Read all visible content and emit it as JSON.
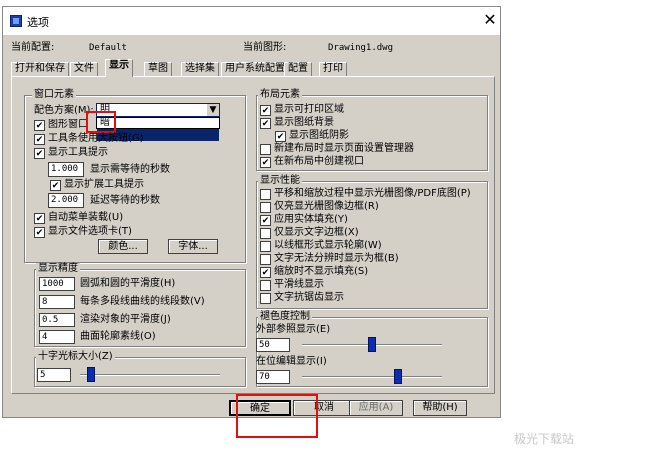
{
  "window": {
    "title": "选项",
    "close_glyph": "✕",
    "current_config_label": "当前配置:",
    "current_config_value": "Default",
    "current_drawing_label": "当前图形:",
    "current_drawing_value": "Drawing1.dwg"
  },
  "tabs": [
    {
      "label": "打开和保存"
    },
    {
      "label": "文件"
    },
    {
      "label": "显示"
    },
    {
      "label": "草图"
    },
    {
      "label": "选择集"
    },
    {
      "label": "用户系统配置"
    },
    {
      "label": "配置"
    },
    {
      "label": "打印"
    }
  ],
  "window_elements": {
    "title": "窗口元素",
    "color_scheme_label": "配色方案(M):",
    "color_scheme_value": "明",
    "color_scheme_options": [
      "暗"
    ],
    "checkboxes": [
      {
        "label": "图形窗口中显示滚动条",
        "checked": true
      },
      {
        "label": "工具条使用大按钮(G)",
        "checked": true
      },
      {
        "label": "显示工具提示",
        "checked": true
      }
    ],
    "tooltip_delay_value": "1.000",
    "tooltip_delay_label": "显示需等待的秒数",
    "extended_tooltip": {
      "label": "显示扩展工具提示",
      "checked": true
    },
    "extended_delay_value": "2.000",
    "extended_delay_label": "延迟等待的秒数",
    "auto_menu": {
      "label": "自动菜单装载(U)",
      "checked": true
    },
    "file_tab": {
      "label": "显示文件选项卡(T)",
      "checked": true
    },
    "color_button": "颜色...",
    "font_button": "字体..."
  },
  "display_precision": {
    "title": "显示精度",
    "rows": [
      {
        "value": "1000",
        "label": "圆弧和圆的平滑度(H)"
      },
      {
        "value": "8",
        "label": "每条多段线曲线的线段数(V)"
      },
      {
        "value": "0.5",
        "label": "渲染对象的平滑度(J)"
      },
      {
        "value": "4",
        "label": "曲面轮廓素线(O)"
      }
    ]
  },
  "crosshair": {
    "title": "十字光标大小(Z)",
    "value": "5",
    "slider_fraction": 0.05
  },
  "layout_elements": {
    "title": "布局元素",
    "checkboxes": [
      {
        "label": "显示可打印区域",
        "checked": true
      },
      {
        "label": "显示图纸背景",
        "checked": true
      },
      {
        "label": "显示图纸阴影",
        "checked": true
      },
      {
        "label": "新建布局时显示页面设置管理器",
        "checked": false
      },
      {
        "label": "在新布局中创建视口",
        "checked": true
      }
    ]
  },
  "display_performance": {
    "title": "显示性能",
    "checkboxes": [
      {
        "label": "平移和缩放过程中显示光栅图像/PDF底图(P)",
        "checked": false
      },
      {
        "label": "仅亮显光栅图像边框(R)",
        "checked": false
      },
      {
        "label": "应用实体填充(Y)",
        "checked": true
      },
      {
        "label": "仅显示文字边框(X)",
        "checked": false
      },
      {
        "label": "以线框形式显示轮廓(W)",
        "checked": false
      },
      {
        "label": "文字无法分辨时显示为框(B)",
        "checked": false
      },
      {
        "label": "缩放时不显示填充(S)",
        "checked": true
      },
      {
        "label": "平滑线显示",
        "checked": false
      },
      {
        "label": "文字抗锯齿显示",
        "checked": false
      }
    ]
  },
  "fade_control": {
    "title": "褪色度控制",
    "xref_label": "外部参照显示(E)",
    "xref_value": "50",
    "xref_fraction": 0.5,
    "inplace_label": "在位编辑显示(I)",
    "inplace_value": "70",
    "inplace_fraction": 0.7
  },
  "buttons": {
    "ok": "确定",
    "cancel": "取消",
    "apply": "应用(A)",
    "help": "帮助(H)"
  },
  "watermark": "极光下载站",
  "colors": {
    "dialog_bg": "#d4d0c8",
    "selection": "#0a246a",
    "highlight_box": "#e01010",
    "slider_thumb": "#0b2faa"
  }
}
